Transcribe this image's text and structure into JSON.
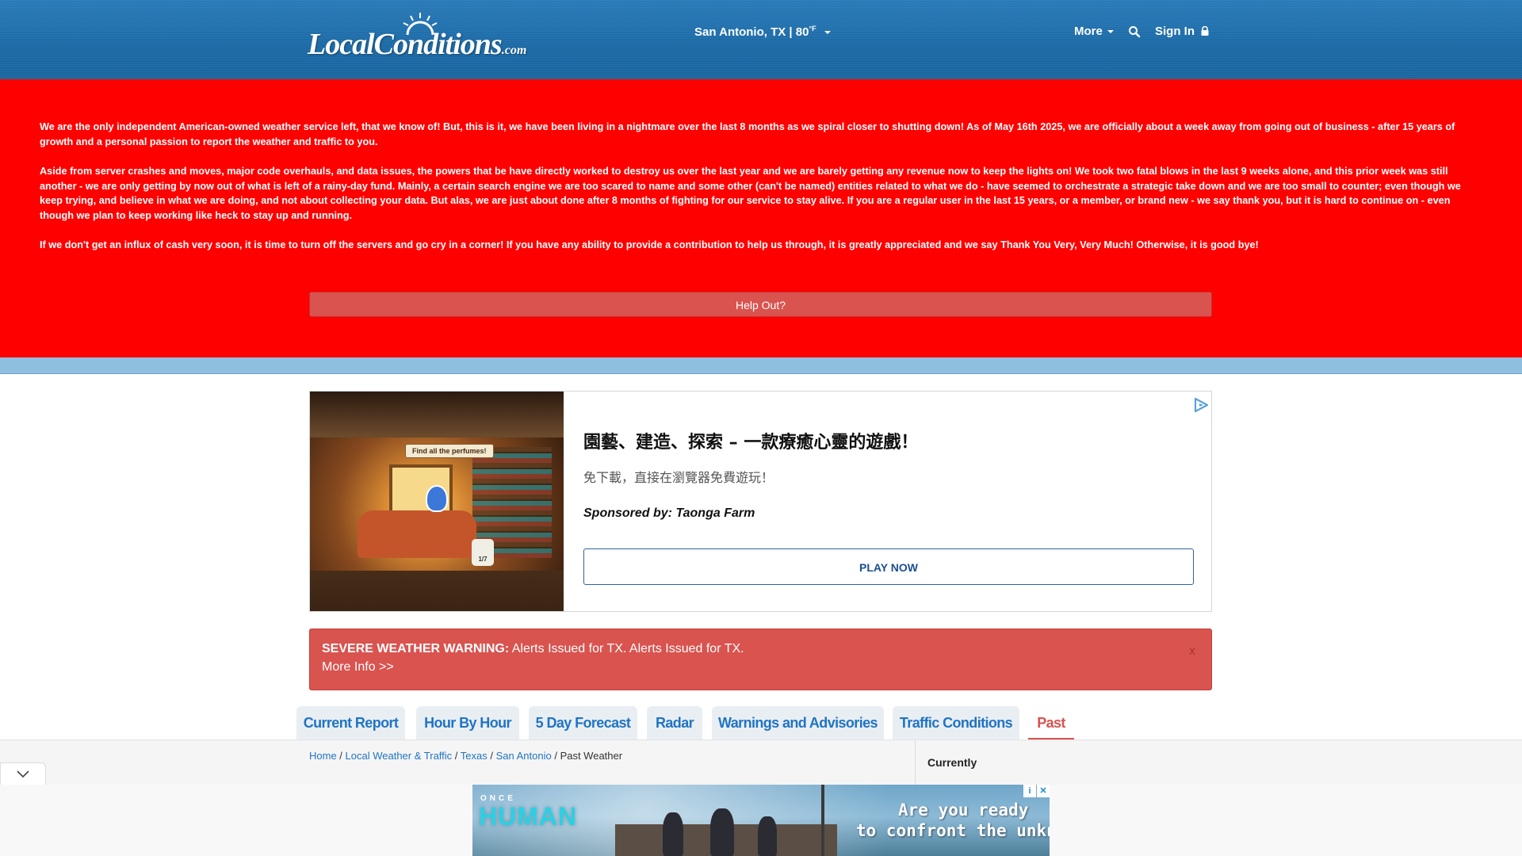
{
  "header": {
    "logo_main": "LocalConditions",
    "logo_suffix": ".com",
    "location": "San Antonio, TX | 80",
    "temp_unit": "°F",
    "more_label": "More",
    "signin_label": "Sign In"
  },
  "banner": {
    "paragraph1": "We are the only independent American-owned weather service left, that we know of! But, this is it, we have been living in a nightmare over the last 8 months as we spiral closer to shutting down! As of May 16th 2025, we are officially about a week away from going out of business - after 15 years of growth and a personal passion to report the weather and traffic to you.",
    "paragraph2": "Aside from server crashes and moves, major code overhauls, and data issues, the powers that be have directly worked to destroy us over the last year and we are barely getting any revenue now to keep the lights on! We took two fatal blows in the last 9 weeks alone, and this prior week was still another - we are only getting by now out of what is left of a rainy-day fund. Mainly, a certain search engine we are too scared to name and some other (can't be named) entities related to what we do - have seemed to orchestrate a strategic take down and we are too small to counter; even though we keep trying, and believe in what we are doing, and not about collecting your data. But alas, we are just about done after 8 months of fighting for our service to stay alive. If you are a regular user in the last 15 years, or a member, or brand new - we say thank you, but it is hard to continue on - even though we plan to keep working like heck to stay up and running.",
    "paragraph3": "If we don't get an influx of cash very soon, it is time to turn off the servers and go cry in a corner! If you have any ability to provide a contribution to help us through, it is greatly appreciated and we say Thank You Very, Very Much! Otherwise, it is good bye!",
    "help_button": "Help Out?"
  },
  "ad": {
    "image_caption": "Find all the perfumes!",
    "image_counter": "1/7",
    "title": "園藝、建造、探索 – 一款療癒心靈的遊戲！",
    "subtitle": "免下載，直接在瀏覽器免費遊玩！",
    "sponsor": "Sponsored by: Taonga Farm",
    "cta": "PLAY NOW"
  },
  "warning": {
    "label": "SEVERE WEATHER WARNING:",
    "text": " Alerts Issued for TX. Alerts Issued for TX.",
    "more": "More Info >>",
    "close": "x"
  },
  "tabs": [
    {
      "label": "Current Report"
    },
    {
      "label": "Hour By Hour"
    },
    {
      "label": "5 Day Forecast"
    },
    {
      "label": "Radar"
    },
    {
      "label": "Warnings and Advisories"
    },
    {
      "label": "Traffic Conditions"
    },
    {
      "label": "Past"
    }
  ],
  "breadcrumb": {
    "home": "Home",
    "local": "Local Weather & Traffic",
    "state": "Texas",
    "city": "San Antonio",
    "current": "Past Weather",
    "sep": " / "
  },
  "sidebar": {
    "currently": "Currently"
  },
  "bottom_ad": {
    "brand_top": "ONCE",
    "brand_main": "HUMAN",
    "tagline_1": "Are you ready",
    "tagline_2": "to confront the unknown?",
    "badge_info": "i",
    "badge_close": "✕"
  },
  "colors": {
    "header_blue": "#1c6aa6",
    "banner_red": "#ff0000",
    "alert_red": "#d9534f",
    "link_blue": "#1f74c4"
  }
}
